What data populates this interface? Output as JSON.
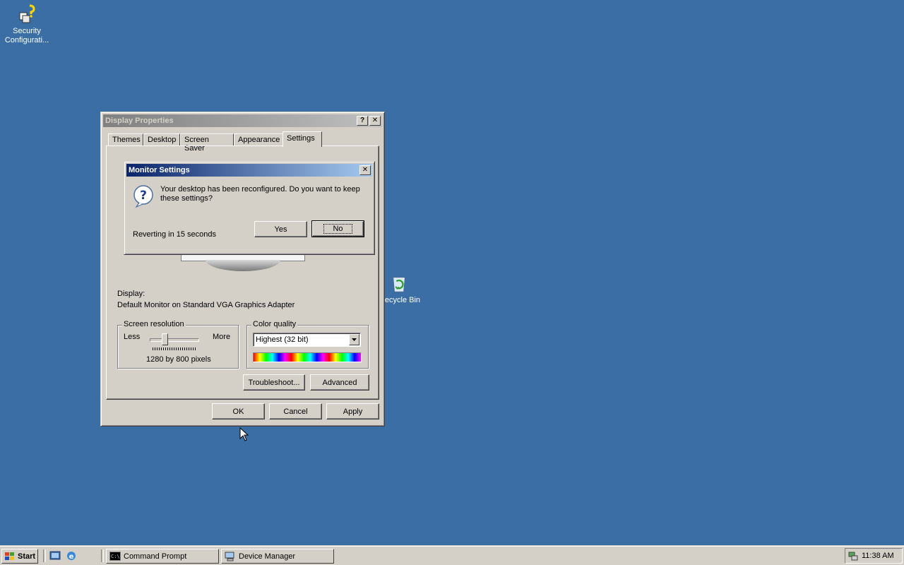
{
  "desktop": {
    "icons": [
      {
        "label_line1": "Security",
        "label_line2": "Configurati..."
      },
      {
        "label_line1": "Recycle Bin",
        "label_line2": ""
      }
    ]
  },
  "display_properties": {
    "title": "Display Properties",
    "help_btn": "?",
    "close_btn": "✕",
    "tabs": [
      "Themes",
      "Desktop",
      "Screen Saver",
      "Appearance",
      "Settings"
    ],
    "selected_tab": "Settings",
    "display_label": "Display:",
    "display_value": "Default Monitor on Standard VGA Graphics Adapter",
    "screen_resolution": {
      "label": "Screen resolution",
      "less": "Less",
      "more": "More",
      "value": "1280 by 800 pixels"
    },
    "color_quality": {
      "label": "Color quality",
      "selected": "Highest (32 bit)"
    },
    "troubleshoot_label": "Troubleshoot...",
    "advanced_label": "Advanced",
    "ok_label": "OK",
    "cancel_label": "Cancel",
    "apply_label": "Apply"
  },
  "monitor_settings": {
    "title": "Monitor Settings",
    "close_btn": "✕",
    "message_line1": "Your desktop has been reconfigured.  Do you want to keep",
    "message_line2": "these settings?",
    "reverting": "Reverting in 15 seconds",
    "yes_label": "Yes",
    "no_label": "No"
  },
  "taskbar": {
    "start_label": "Start",
    "tasks": [
      "Command Prompt",
      "Device Manager"
    ],
    "clock": "11:38 AM"
  },
  "colors": {
    "desktop": "#3a6ea5",
    "face": "#d4d0c8",
    "active_title": "#0a246a",
    "inactive_title": "#808080"
  }
}
